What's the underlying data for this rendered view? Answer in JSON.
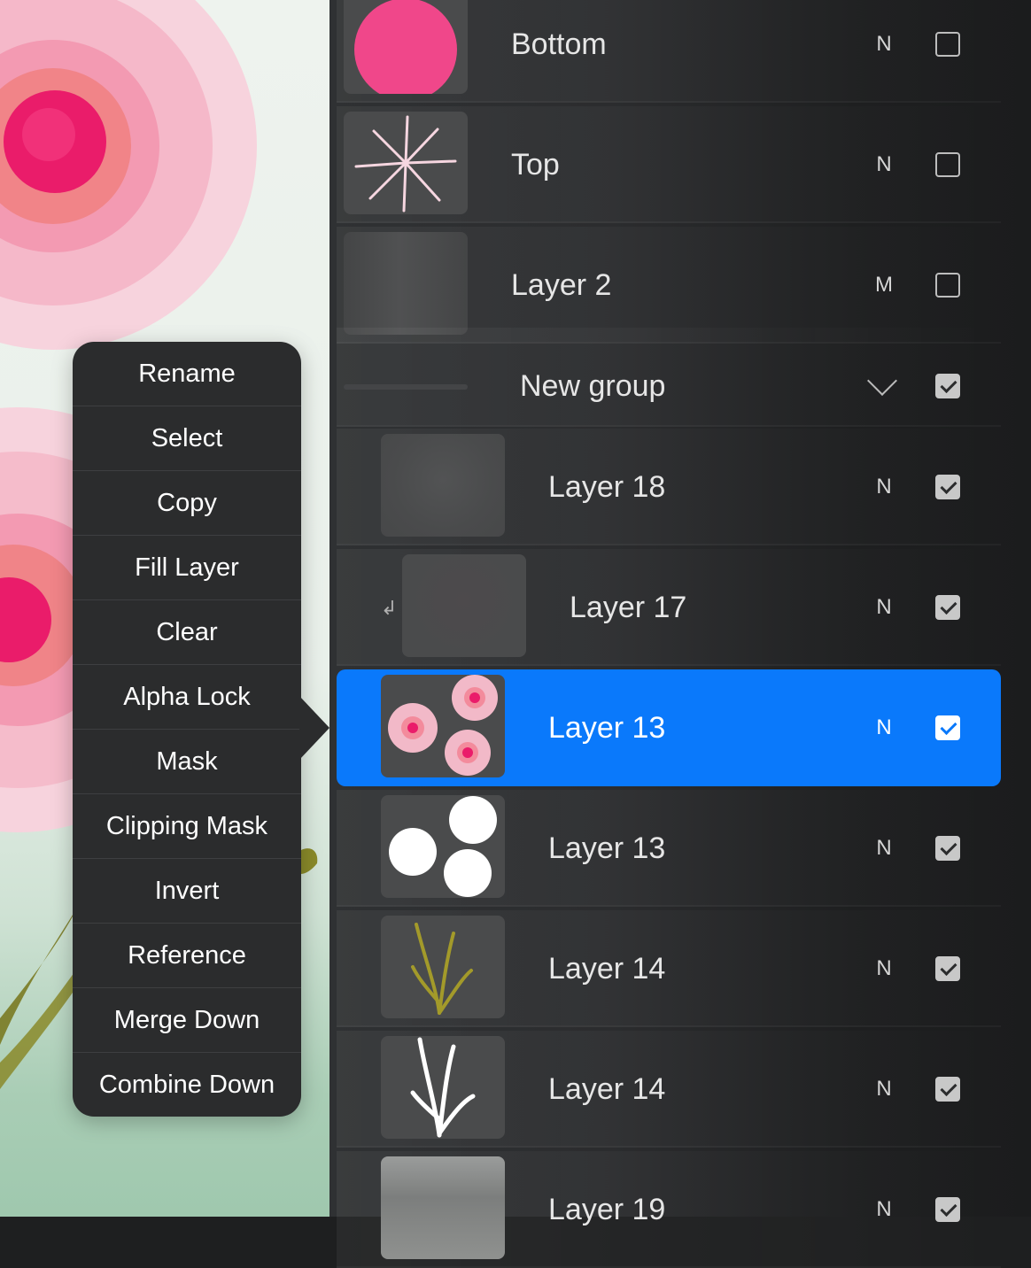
{
  "context_menu": {
    "items": [
      "Rename",
      "Select",
      "Copy",
      "Fill Layer",
      "Clear",
      "Alpha Lock",
      "Mask",
      "Clipping Mask",
      "Invert",
      "Reference",
      "Merge Down",
      "Combine Down"
    ]
  },
  "layers": [
    {
      "name": "Bottom",
      "blend": "N",
      "visible": false,
      "thumb": "pink-circle"
    },
    {
      "name": "Top",
      "blend": "N",
      "visible": false,
      "thumb": "line-burst"
    },
    {
      "name": "Layer 2",
      "blend": "M",
      "visible": false,
      "thumb": "gray-gradient"
    },
    {
      "name": "New group",
      "type": "group",
      "visible": true,
      "thumb": "group-bar",
      "expand_icon": "chevron-down-icon"
    },
    {
      "name": "Layer 18",
      "blend": "N",
      "visible": true,
      "thumb": "gray-soft"
    },
    {
      "name": "Layer 17",
      "blend": "N",
      "visible": true,
      "clipped": true,
      "thumb": "gray-plain",
      "clip_icon": "clipping-arrow-icon"
    },
    {
      "name": "Layer 13",
      "blend": "N",
      "visible": true,
      "selected": true,
      "thumb": "pink-flowers"
    },
    {
      "name": "Layer 13",
      "blend": "N",
      "visible": true,
      "thumb": "white-blobs"
    },
    {
      "name": "Layer 14",
      "blend": "N",
      "visible": true,
      "thumb": "olive-leaves"
    },
    {
      "name": "Layer 14",
      "blend": "N",
      "visible": true,
      "thumb": "white-leaves"
    },
    {
      "name": "Layer 19",
      "blend": "N",
      "visible": true,
      "thumb": "gray-water"
    }
  ],
  "colors": {
    "selected_row": "#0a79fb",
    "menu_background": "#2b2c2d",
    "flower_pink": "#f0478a"
  }
}
